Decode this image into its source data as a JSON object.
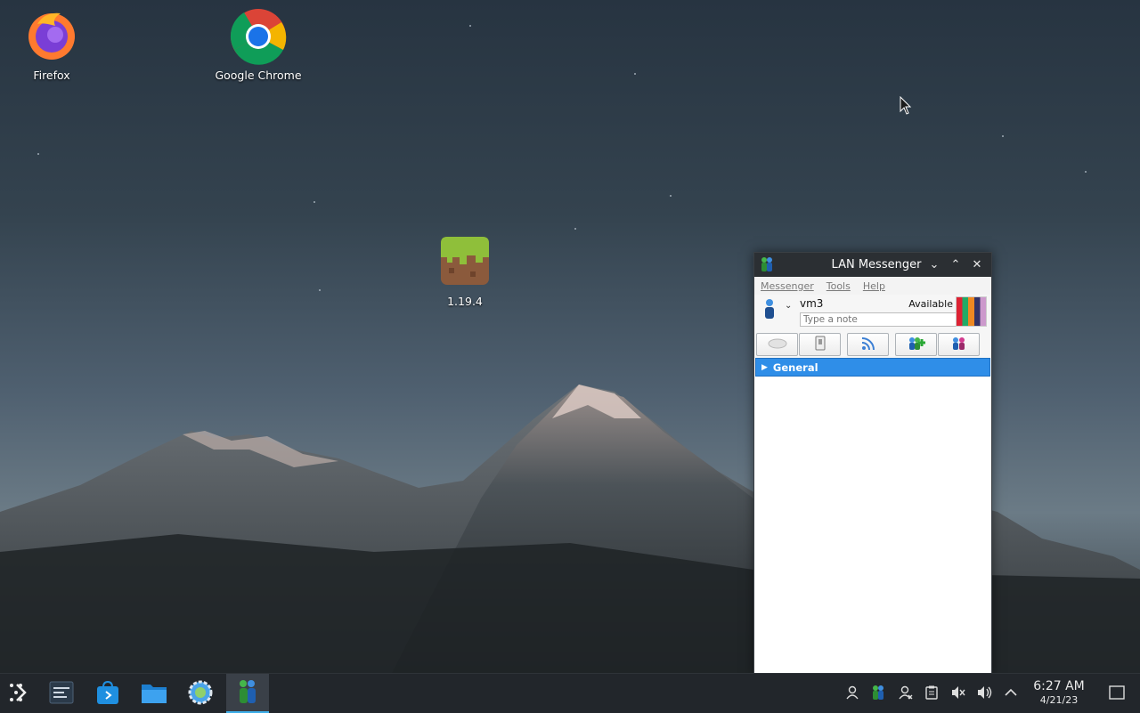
{
  "desktop": {
    "icons": [
      {
        "label": "Firefox"
      },
      {
        "label": "Google Chrome"
      },
      {
        "label": "1.19.4"
      }
    ]
  },
  "lan_messenger": {
    "title": "LAN Messenger",
    "menu": [
      "Messenger",
      "Tools",
      "Help"
    ],
    "username": "vm3",
    "status": "Available",
    "note_placeholder": "Type a note",
    "toolbar_icons": [
      "chat-icon",
      "file-transfer-icon",
      "broadcast-icon",
      "add-contact-icon",
      "group-icon"
    ],
    "groups": [
      {
        "name": "General",
        "expanded": false
      }
    ],
    "selection_color": "#3091e9"
  },
  "taskbar": {
    "apps": [
      "application-launcher-icon",
      "task-overview-icon",
      "discover-store-icon",
      "file-manager-icon",
      "system-settings-icon",
      "lan-messenger-icon"
    ],
    "tray": [
      "user-icon",
      "lan-messenger-tray-icon",
      "network-icon",
      "clipboard-icon",
      "muted-audio-icon",
      "volume-icon",
      "expand-tray-icon"
    ],
    "time": "6:27 AM",
    "date": "4/21/23",
    "accent": "#3daee9"
  }
}
